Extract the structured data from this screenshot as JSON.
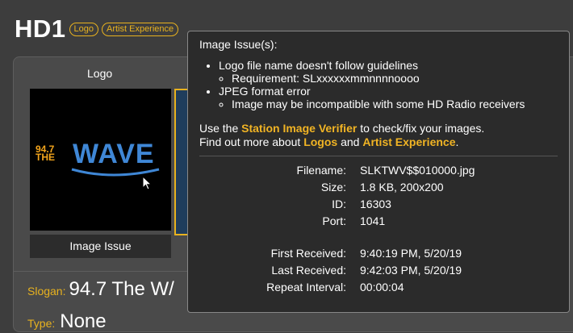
{
  "header": {
    "title": "HD1",
    "badges": [
      "Logo",
      "Artist Experience"
    ]
  },
  "logo_card": {
    "label": "Logo",
    "logo_image": {
      "number": [
        "94.7",
        "THE"
      ],
      "name": "WAVE"
    },
    "issue_button": "Image Issue"
  },
  "details": {
    "slogan_label": "Slogan:",
    "slogan_value": "94.7 The W/",
    "type_label": "Type:",
    "type_value": "None"
  },
  "tooltip": {
    "heading": "Image Issue(s):",
    "issues": [
      {
        "title": "Logo file name doesn't follow guidelines",
        "detail": "Requirement: SLxxxxxxmmnnnnoooo"
      },
      {
        "title": "JPEG format error",
        "detail": "Image may be incompatible with some HD Radio receivers"
      }
    ],
    "verifier_line": {
      "prefix": "Use the ",
      "link": "Station Image Verifier",
      "suffix": " to check/fix your images."
    },
    "more_line": {
      "prefix": "Find out more about ",
      "link1": "Logos",
      "mid": " and ",
      "link2": "Artist Experience",
      "suffix": "."
    },
    "info": {
      "filename_label": "Filename:",
      "filename": "SLKTWV$$010000.jpg",
      "size_label": "Size:",
      "size": "1.8 KB, 200x200",
      "id_label": "ID:",
      "id": "16303",
      "port_label": "Port:",
      "port": "1041",
      "first_label": "First Received:",
      "first": "9:40:19 PM, 5/20/19",
      "last_label": "Last Received:",
      "last": "9:42:03 PM, 5/20/19",
      "repeat_label": "Repeat Interval:",
      "repeat": "00:00:04"
    }
  },
  "colors": {
    "accent": "#e8b21f",
    "background": "#3d3d3d",
    "tooltip_bg": "#2b2b2b",
    "logo_blue": "#3f87d6",
    "logo_orange": "#f3a51c"
  },
  "icons": {
    "pointer": "mouse-pointer-icon"
  }
}
